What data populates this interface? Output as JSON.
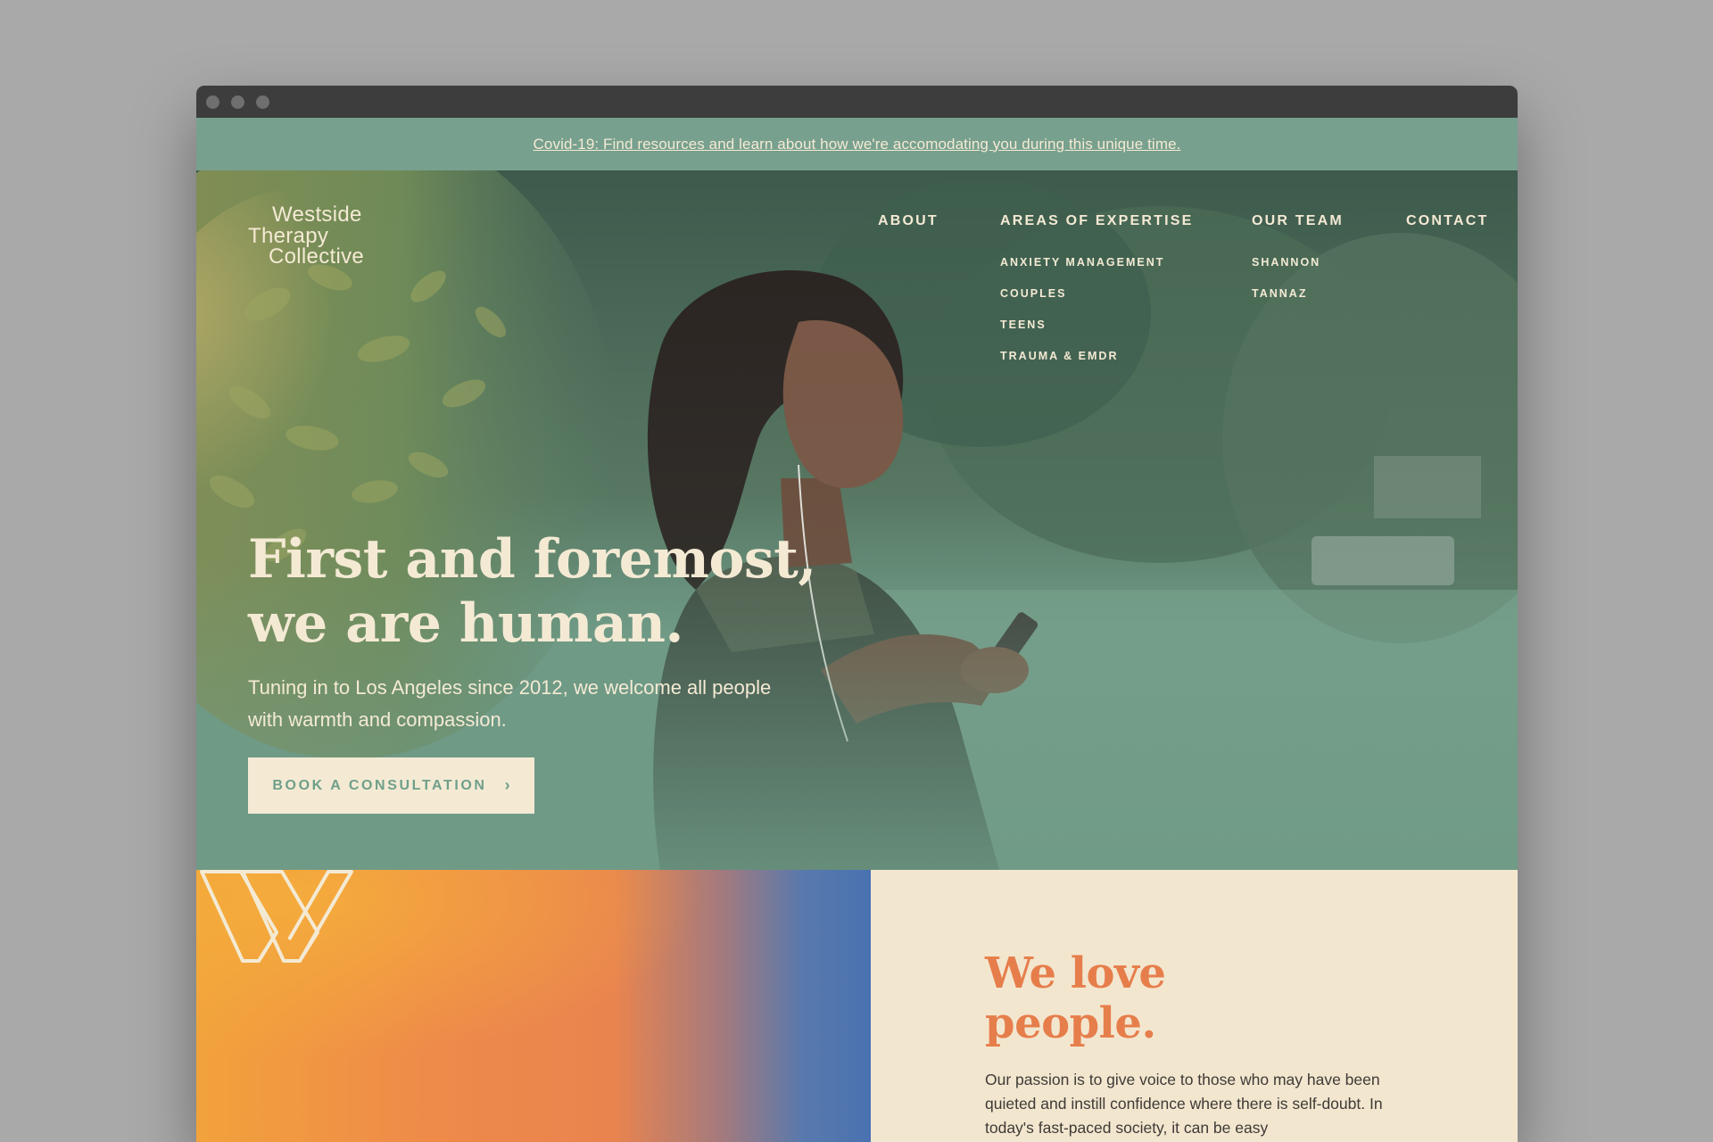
{
  "banner": {
    "covid_link": "Covid-19: Find resources and learn about how we're accomodating you during this unique time."
  },
  "brand": {
    "logo_lines": [
      "Westside",
      "Therapy",
      "Collective"
    ]
  },
  "nav": {
    "about": "ABOUT",
    "expertise": {
      "label": "AREAS OF EXPERTISE",
      "items": [
        "ANXIETY MANAGEMENT",
        "COUPLES",
        "TEENS",
        "TRAUMA & EMDR"
      ]
    },
    "team": {
      "label": "OUR TEAM",
      "items": [
        "SHANNON",
        "TANNAZ"
      ]
    },
    "contact": "CONTACT"
  },
  "hero": {
    "headline_line1": "First and foremost,",
    "headline_line2": "we are human.",
    "subtext": "Tuning in to Los Angeles since 2012, we welcome all people with warmth and compassion.",
    "cta_label": "BOOK A CONSULTATION",
    "cta_icon": "chevron-right-icon"
  },
  "section": {
    "title_line1": "We love",
    "title_line2": "people.",
    "body": "Our passion is to give voice to those who may have been quieted and instill confidence where there is self-doubt. In today's fast-paced society, it can be easy"
  },
  "colors": {
    "banner_bg": "#78a08e",
    "hero_green": "#6f9a86",
    "cream": "#f4ead4",
    "accent_orange": "#e67e4b",
    "gradient_blue": "#4a72b0"
  }
}
